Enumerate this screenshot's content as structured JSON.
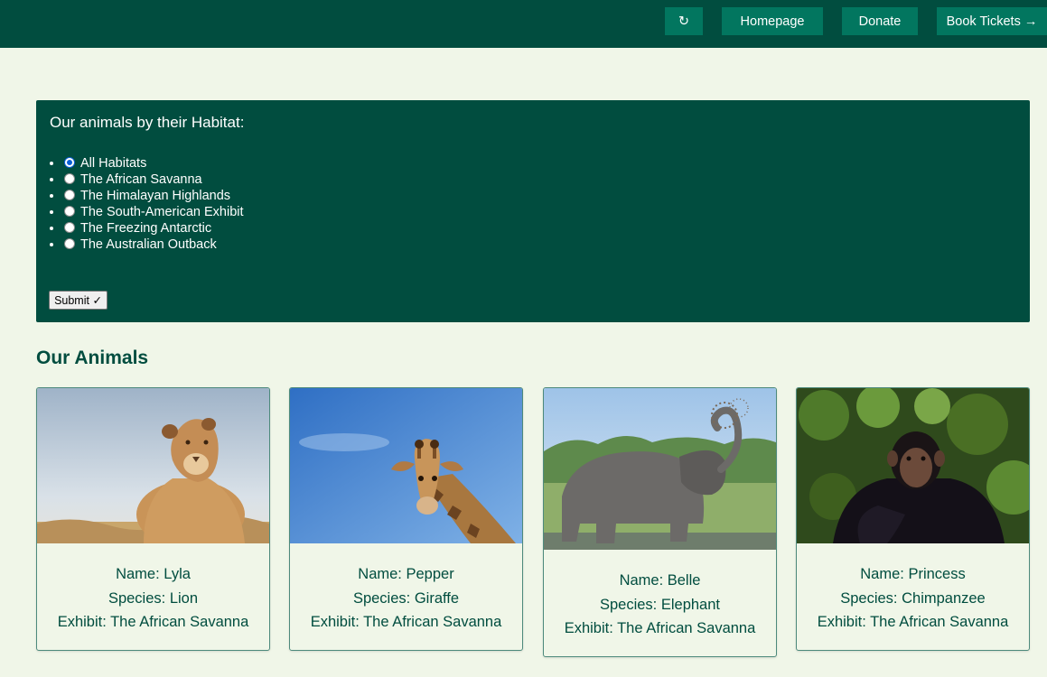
{
  "header": {
    "refresh_icon": "↻",
    "homepage_label": "Homepage",
    "donate_label": "Donate",
    "book_label": "Book Tickets →"
  },
  "habitat_form": {
    "title": "Our animals by their Habitat:",
    "options": [
      {
        "label": "All Habitats",
        "checked": true
      },
      {
        "label": "The African Savanna",
        "checked": false
      },
      {
        "label": "The Himalayan Highlands",
        "checked": false
      },
      {
        "label": "The South-American Exhibit",
        "checked": false
      },
      {
        "label": "The Freezing Antarctic",
        "checked": false
      },
      {
        "label": "The Australian Outback",
        "checked": false
      }
    ],
    "submit_label": "Submit ✓"
  },
  "animals_section": {
    "title": "Our Animals",
    "cards": [
      {
        "name": "Name: Lyla",
        "species": "Species: Lion",
        "exhibit": "Exhibit: The African Savanna"
      },
      {
        "name": "Name: Pepper",
        "species": "Species: Giraffe",
        "exhibit": "Exhibit: The African Savanna"
      },
      {
        "name": "Name: Belle",
        "species": "Species: Elephant",
        "exhibit": "Exhibit: The African Savanna"
      },
      {
        "name": "Name: Princess",
        "species": "Species: Chimpanzee",
        "exhibit": "Exhibit: The African Savanna"
      }
    ]
  },
  "colors": {
    "header_bg": "#014d3f",
    "button_bg": "#02765f",
    "page_bg": "#f0f6e8",
    "accent_text": "#014d3f"
  }
}
